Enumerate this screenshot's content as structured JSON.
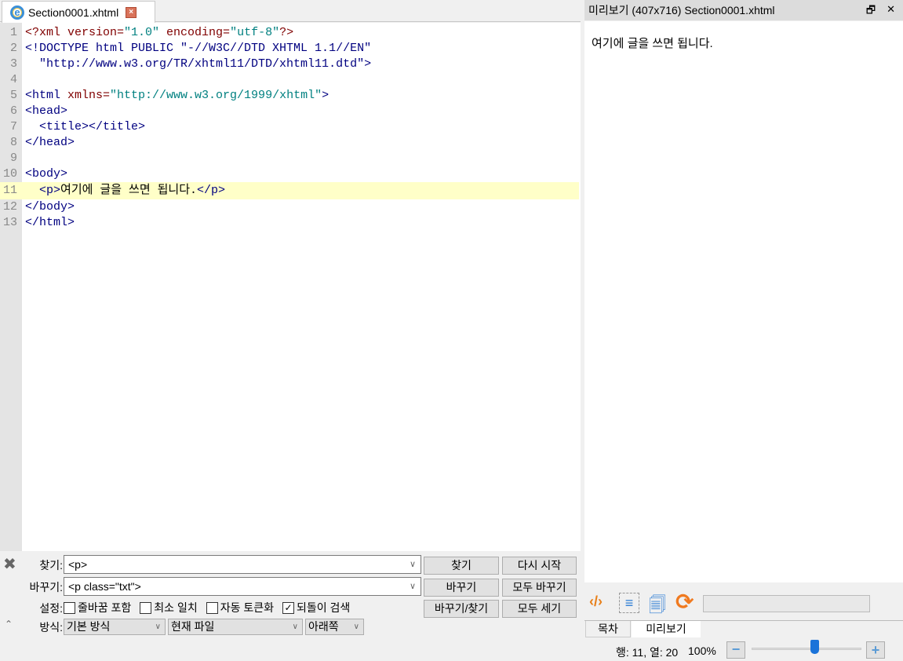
{
  "editor_tab": {
    "title": "Section0001.xhtml",
    "icon": "ie-file-icon",
    "close_icon": "close-icon"
  },
  "code_lines": [
    {
      "n": "1",
      "segs": [
        [
          "<?xml ",
          "a"
        ],
        [
          "version=",
          "a"
        ],
        [
          "\"1.0\" ",
          "v"
        ],
        [
          "encoding=",
          "a"
        ],
        [
          "\"utf-8\"",
          "v"
        ],
        [
          "?>",
          "a"
        ]
      ]
    },
    {
      "n": "2",
      "segs": [
        [
          "<!DOCTYPE html PUBLIC \"-//W3C//DTD XHTML 1.1//EN\"",
          "t"
        ]
      ]
    },
    {
      "n": "3",
      "segs": [
        [
          "  \"http://www.w3.org/TR/xhtml11/DTD/xhtml11.dtd\">",
          "t"
        ]
      ]
    },
    {
      "n": "4",
      "segs": []
    },
    {
      "n": "5",
      "segs": [
        [
          "<html ",
          "t"
        ],
        [
          "xmlns=",
          "a"
        ],
        [
          "\"http://www.w3.org/1999/xhtml\"",
          "v"
        ],
        [
          ">",
          "t"
        ]
      ]
    },
    {
      "n": "6",
      "segs": [
        [
          "<head>",
          "t"
        ]
      ]
    },
    {
      "n": "7",
      "segs": [
        [
          "  <title></title>",
          "t"
        ]
      ]
    },
    {
      "n": "8",
      "segs": [
        [
          "</head>",
          "t"
        ]
      ]
    },
    {
      "n": "9",
      "segs": []
    },
    {
      "n": "10",
      "segs": [
        [
          "<body>",
          "t"
        ]
      ]
    },
    {
      "n": "11",
      "segs": [
        [
          "  <p>",
          "t"
        ],
        [
          "여기에 글을 쓰면 됩니다.",
          "x"
        ],
        [
          "</p>",
          "t"
        ]
      ]
    },
    {
      "n": "12",
      "segs": [
        [
          "</body>",
          "t"
        ]
      ]
    },
    {
      "n": "13",
      "segs": [
        [
          "</html>",
          "t"
        ]
      ]
    }
  ],
  "current_line": 11,
  "preview": {
    "title": "미리보기 (407x716) Section0001.xhtml",
    "float_icon": "restore-icon",
    "close_icon": "close-icon",
    "content": "여기에 글을 쓰면 됩니다."
  },
  "find": {
    "find_label": "찾기:",
    "find_value": "<p>",
    "replace_label": "바꾸기:",
    "replace_value": "<p class=\"txt\">",
    "options_label": "설정:",
    "options": [
      {
        "label": "줄바꿈 포함",
        "checked": false
      },
      {
        "label": "최소 일치",
        "checked": false
      },
      {
        "label": "자동 토큰화",
        "checked": false
      },
      {
        "label": "되돌이 검색",
        "checked": true
      }
    ],
    "mode_label": "방식:",
    "mode": "기본 방식",
    "scope": "현재 파일",
    "direction": "아래쪽",
    "buttons": {
      "find": "찾기",
      "restart": "다시 시작",
      "replace": "바꾸기",
      "replace_all": "모두 바꾸기",
      "replace_find": "바꾸기/찾기",
      "count_all": "모두 세기"
    }
  },
  "bottom_tabs": [
    {
      "label": "목차",
      "active": false
    },
    {
      "label": "미리보기",
      "active": true
    }
  ],
  "status": {
    "position": "행: 11, 열: 20",
    "zoom": "100%",
    "zoom_percent": 100
  },
  "colors": {
    "tag": "#000080",
    "attribute": "#800000",
    "value": "#008080",
    "current_line": "#ffffc8"
  }
}
